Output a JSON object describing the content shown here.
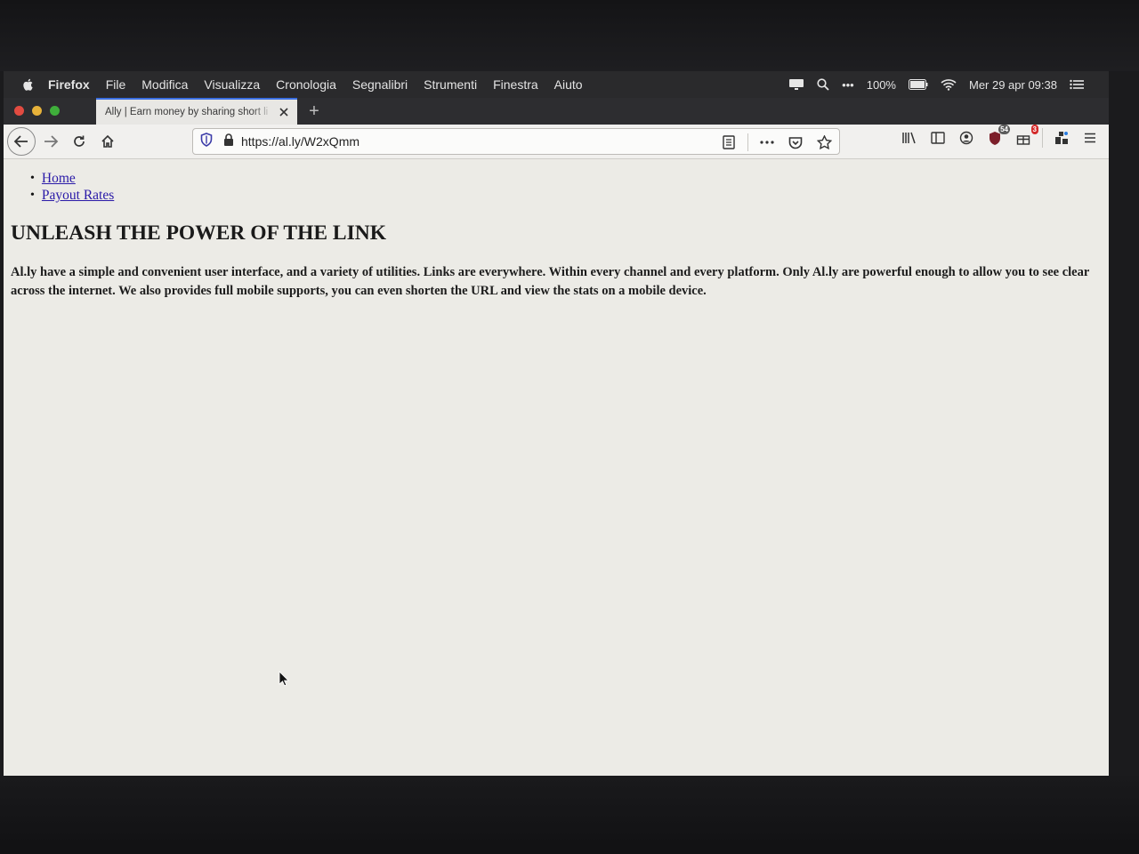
{
  "menubar": {
    "items": [
      "Firefox",
      "File",
      "Modifica",
      "Visualizza",
      "Cronologia",
      "Segnalibri",
      "Strumenti",
      "Finestra",
      "Aiuto"
    ],
    "battery": "100%",
    "datetime": "Mer 29 apr  09:38",
    "more": "•••"
  },
  "tab": {
    "title": "Ally | Earn money by sharing short li",
    "new_tab": "+"
  },
  "toolbar": {
    "url": "https://al.ly/W2xQmm",
    "badge_a": "54",
    "badge_b": "3"
  },
  "page": {
    "nav": [
      "Home",
      "Payout Rates"
    ],
    "headline": "UNLEASH THE POWER OF THE LINK",
    "body": "Al.ly have a simple and convenient user interface, and a variety of utilities. Links are everywhere. Within every channel and every platform. Only Al.ly are powerful enough to allow you to see clear across the internet. We also provides full mobile supports, you can even shorten the URL and view the stats on a mobile device."
  },
  "colors": {
    "link": "#2a1aa8",
    "tab_accent": "#3b6fe0",
    "page_bg": "#ecebe6"
  }
}
